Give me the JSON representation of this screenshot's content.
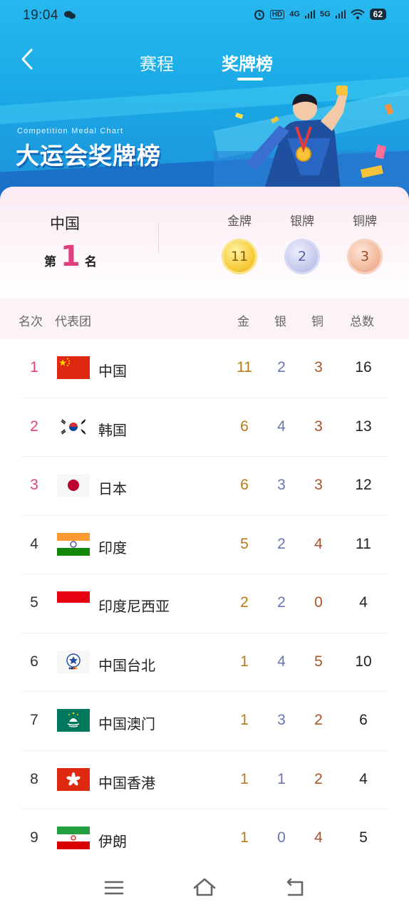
{
  "status_bar": {
    "time": "19:04",
    "network_1": "4G",
    "network_2": "5G",
    "hd": "HD",
    "battery": "62"
  },
  "header": {
    "tabs": [
      {
        "label": "赛程",
        "active": false
      },
      {
        "label": "奖牌榜",
        "active": true
      }
    ]
  },
  "banner": {
    "subtitle": "Competition Medal Chart",
    "title": "大运会奖牌榜"
  },
  "summary": {
    "country": "中国",
    "rank_prefix": "第",
    "rank": "1",
    "rank_suffix": "名",
    "gold_label": "金牌",
    "silver_label": "银牌",
    "bronze_label": "铜牌",
    "gold": "11",
    "silver": "2",
    "bronze": "3"
  },
  "table": {
    "headers": {
      "rank": "名次",
      "team": "代表团",
      "gold": "金",
      "silver": "银",
      "bronze": "铜",
      "total": "总数"
    },
    "rows": [
      {
        "rank": "1",
        "flag": "china-flag",
        "name": "中国",
        "gold": "11",
        "silver": "2",
        "bronze": "3",
        "total": "16"
      },
      {
        "rank": "2",
        "flag": "korea-flag",
        "name": "韩国",
        "gold": "6",
        "silver": "4",
        "bronze": "3",
        "total": "13"
      },
      {
        "rank": "3",
        "flag": "japan-flag",
        "name": "日本",
        "gold": "6",
        "silver": "3",
        "bronze": "3",
        "total": "12"
      },
      {
        "rank": "4",
        "flag": "india-flag",
        "name": "印度",
        "gold": "5",
        "silver": "2",
        "bronze": "4",
        "total": "11"
      },
      {
        "rank": "5",
        "flag": "indonesia-flag",
        "name": "印度尼西亚",
        "gold": "2",
        "silver": "2",
        "bronze": "0",
        "total": "4"
      },
      {
        "rank": "6",
        "flag": "chinese-taipei-flag",
        "name": "中国台北",
        "gold": "1",
        "silver": "4",
        "bronze": "5",
        "total": "10"
      },
      {
        "rank": "7",
        "flag": "macao-flag",
        "name": "中国澳门",
        "gold": "1",
        "silver": "3",
        "bronze": "2",
        "total": "6"
      },
      {
        "rank": "8",
        "flag": "hong-kong-flag",
        "name": "中国香港",
        "gold": "1",
        "silver": "1",
        "bronze": "2",
        "total": "4"
      },
      {
        "rank": "9",
        "flag": "iran-flag",
        "name": "伊朗",
        "gold": "1",
        "silver": "0",
        "bronze": "4",
        "total": "5"
      }
    ]
  },
  "colors": {
    "accent_pink": "#e0407e",
    "banner_blue": "#1aa9e6",
    "gold_text": "#b87a1a",
    "silver_text": "#6b75b0",
    "bronze_text": "#a8552a"
  }
}
